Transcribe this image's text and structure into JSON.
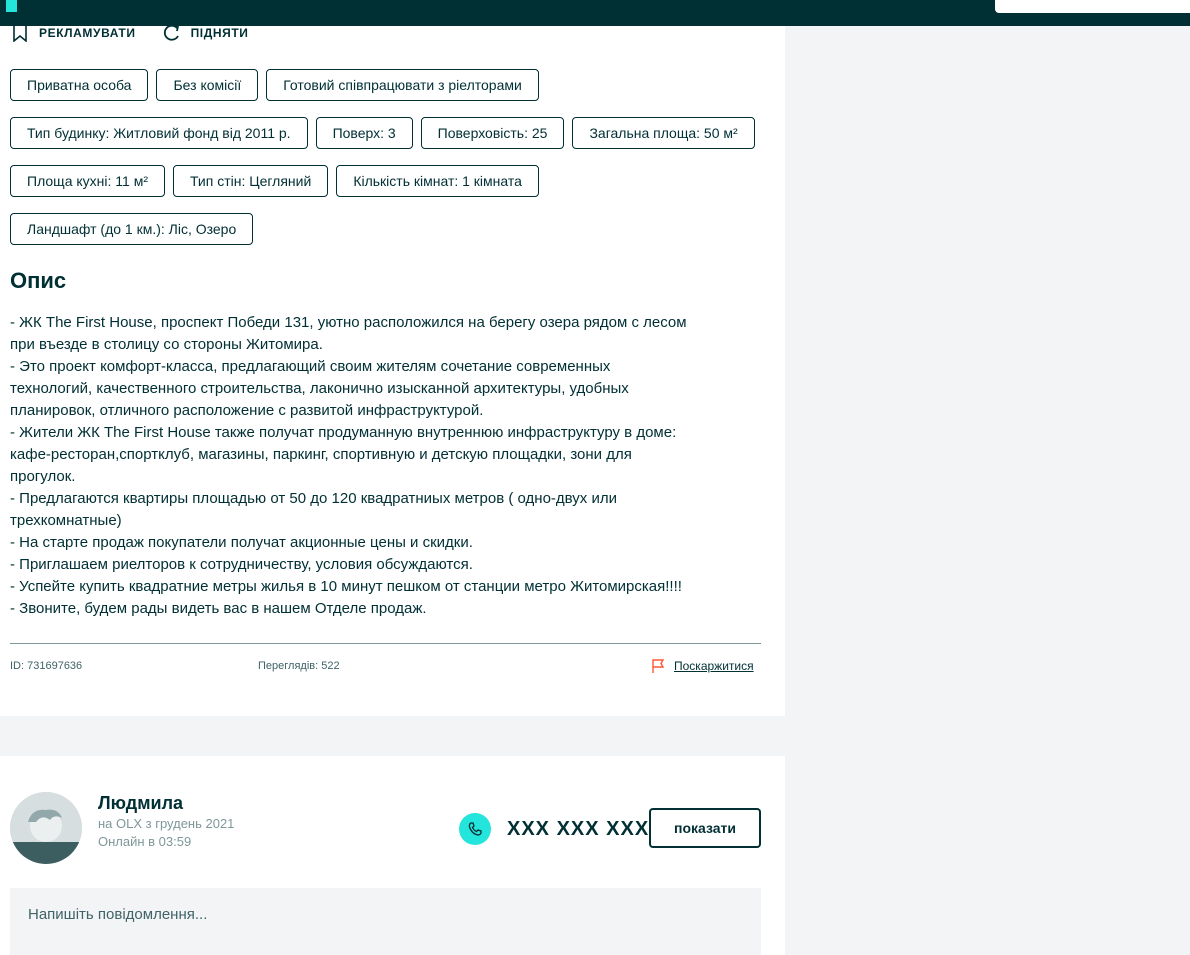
{
  "actions": {
    "promote_label": "РЕКЛАМУВАТИ",
    "raise_label": "ПІДНЯТИ"
  },
  "tags": {
    "rows": [
      [
        "Приватна особа",
        "Без комісії",
        "Готовий співпрацювати з ріелторами"
      ],
      [
        "Тип будинку: Житловий фонд від 2011 р.",
        "Поверх: 3",
        "Поверховість: 25",
        "Загальна площа: 50 м²"
      ],
      [
        "Площа кухні: 11 м²",
        "Тип стін: Цегляний",
        "Кількість кімнат: 1 кімната"
      ],
      [
        "Ландшафт (до 1 км.): Ліс, Озеро"
      ]
    ]
  },
  "description": {
    "title": "Опис",
    "lines": [
      "- ЖК The First House, проспект Победи 131, уютно расположился на берегу озера рядом с лесом",
      "при въезде в столицу со стороны Житомира.",
      "- Это проект комфорт-класса, предлагающий своим жителям сочетание современных",
      "технологий, качественного строительства, лаконично изысканной архитектуры, удобных",
      "планировок, отличного расположение с развитой инфраструктурой.",
      "- Жители ЖК The First House также получат продуманную внутреннюю инфраструктуру в доме:",
      "кафе-ресторан,спортклуб, магазины, паркинг, спортивную и детскую площадки, зони для",
      "прогулок.",
      "- Предлагаются квартиры площадью от 50 до 120 квадратниых метров ( одно-двух или",
      "трехкомнатные)",
      "- На старте продаж покупатели получат акционные цены и скидки.",
      "- Приглашаем риелторов к сотрудничеству, условия обсуждаются.",
      "- Успейте купить квадратние метры жилья в 10 минут пешком от станции метро Житомирская!!!!",
      "- Звоните, будем рады видеть вас в нашем Отделе продаж."
    ]
  },
  "meta": {
    "id_text": "ID: 731697636",
    "views_text": "Переглядів: 522",
    "report_label": "Поскаржитися"
  },
  "seller": {
    "name": "Людмила",
    "since": "на OLX з грудень 2021",
    "online": "Онлайн в 03:59",
    "phone_masked": "XXX XXX XXX",
    "show_label": "показати"
  },
  "message": {
    "placeholder": "Напишіть повідомлення..."
  },
  "colors": {
    "brand_dark": "#002f34",
    "brand_accent": "#23e5db",
    "report_flag": "#ff5636",
    "page_bg": "#f2f4f5"
  },
  "icons": [
    "bookmark-icon",
    "refresh-icon",
    "flag-icon",
    "phone-icon",
    "avatar-placeholder"
  ]
}
